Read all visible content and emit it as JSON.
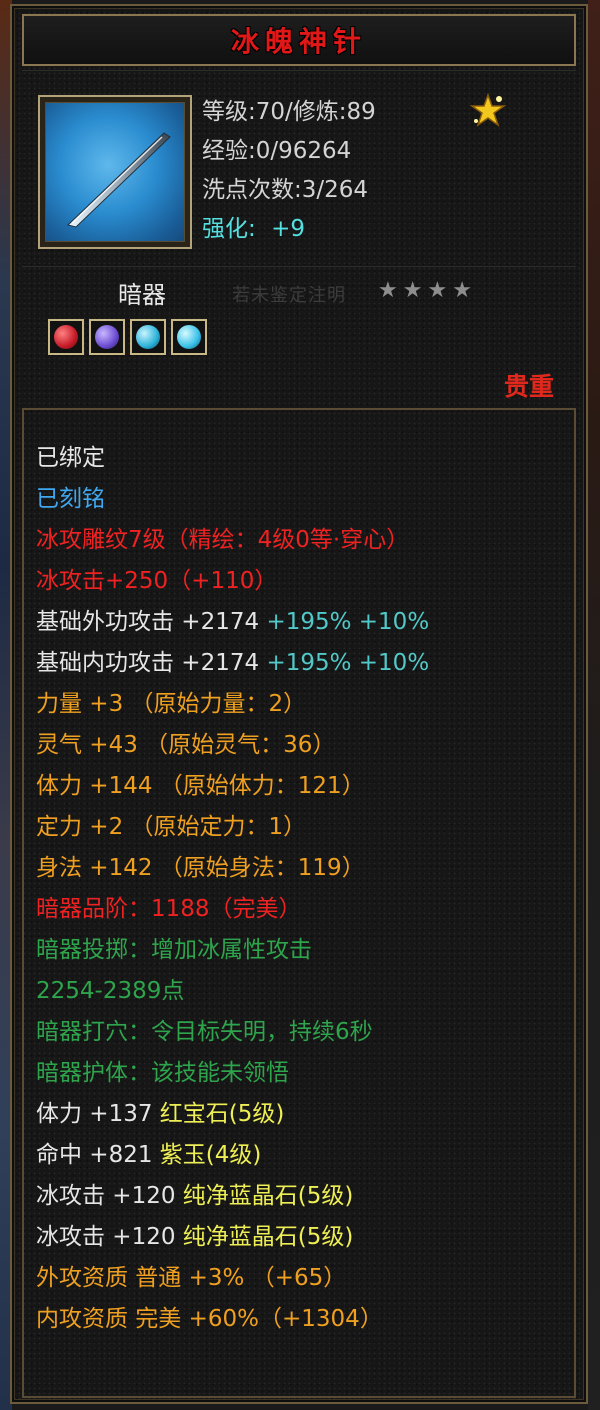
{
  "item": {
    "name": "冰魄神针",
    "icon": "needle-icon",
    "stats": [
      "等级:70/修炼:89",
      "经验:0/96264",
      "洗点次数:3/264"
    ],
    "enhance": {
      "label": "强化:",
      "value": "+9"
    },
    "category": "暗器",
    "faded_text": "若未鉴定注明",
    "stars": 4,
    "gems": [
      {
        "name": "red-gem-icon",
        "color": "#c41a28"
      },
      {
        "name": "purple-gem-icon",
        "color": "#6a4ad0"
      },
      {
        "name": "blue-gem-icon",
        "color": "#2ab0d8"
      },
      {
        "name": "blue-gem-icon",
        "color": "#38c0e8"
      }
    ],
    "quality": "贵重"
  },
  "attributes": [
    {
      "text": "已绑定",
      "color": "white"
    },
    {
      "text": "已刻铭",
      "color": "blue"
    },
    {
      "text": "冰攻雕纹7级（精绘：4级0等·穿心）",
      "color": "red"
    },
    {
      "text": "冰攻击+250（+110）",
      "color": "red"
    },
    {
      "segments": [
        {
          "text": "基础外功攻击 +2174 ",
          "color": "white"
        },
        {
          "text": "+195% +10%",
          "color": "cyan"
        }
      ]
    },
    {
      "segments": [
        {
          "text": "基础内功攻击 +2174 ",
          "color": "white"
        },
        {
          "text": "+195% +10%",
          "color": "cyan"
        }
      ]
    },
    {
      "text": "力量 +3 （原始力量：2）",
      "color": "orange"
    },
    {
      "text": "灵气 +43 （原始灵气：36）",
      "color": "orange"
    },
    {
      "text": "体力 +144 （原始体力：121）",
      "color": "orange"
    },
    {
      "text": "定力 +2 （原始定力：1）",
      "color": "orange"
    },
    {
      "text": "身法 +142 （原始身法：119）",
      "color": "orange"
    },
    {
      "segments": [
        {
          "text": "暗器品阶：1188",
          "color": "red"
        },
        {
          "text": "（完美）",
          "color": "red"
        }
      ]
    },
    {
      "text": "暗器投掷：增加冰属性攻击",
      "color": "green"
    },
    {
      "text": "2254-2389点",
      "color": "green"
    },
    {
      "text": "暗器打穴：令目标失明，持续6秒",
      "color": "green"
    },
    {
      "text": "暗器护体：该技能未领悟",
      "color": "green"
    },
    {
      "segments": [
        {
          "text": "体力 +137 ",
          "color": "white"
        },
        {
          "text": "红宝石(5级)",
          "color": "yellow"
        }
      ]
    },
    {
      "segments": [
        {
          "text": "命中 +821 ",
          "color": "white"
        },
        {
          "text": "紫玉(4级)",
          "color": "yellow"
        }
      ]
    },
    {
      "segments": [
        {
          "text": "冰攻击 +120 ",
          "color": "white"
        },
        {
          "text": "纯净蓝晶石(5级)",
          "color": "yellow"
        }
      ]
    },
    {
      "segments": [
        {
          "text": "冰攻击 +120 ",
          "color": "white"
        },
        {
          "text": "纯净蓝晶石(5级)",
          "color": "yellow"
        }
      ]
    },
    {
      "text": "外攻资质  普通 +3% （+65）",
      "color": "orange"
    },
    {
      "text": "内攻资质  完美 +60%（+1304）",
      "color": "orange"
    }
  ]
}
